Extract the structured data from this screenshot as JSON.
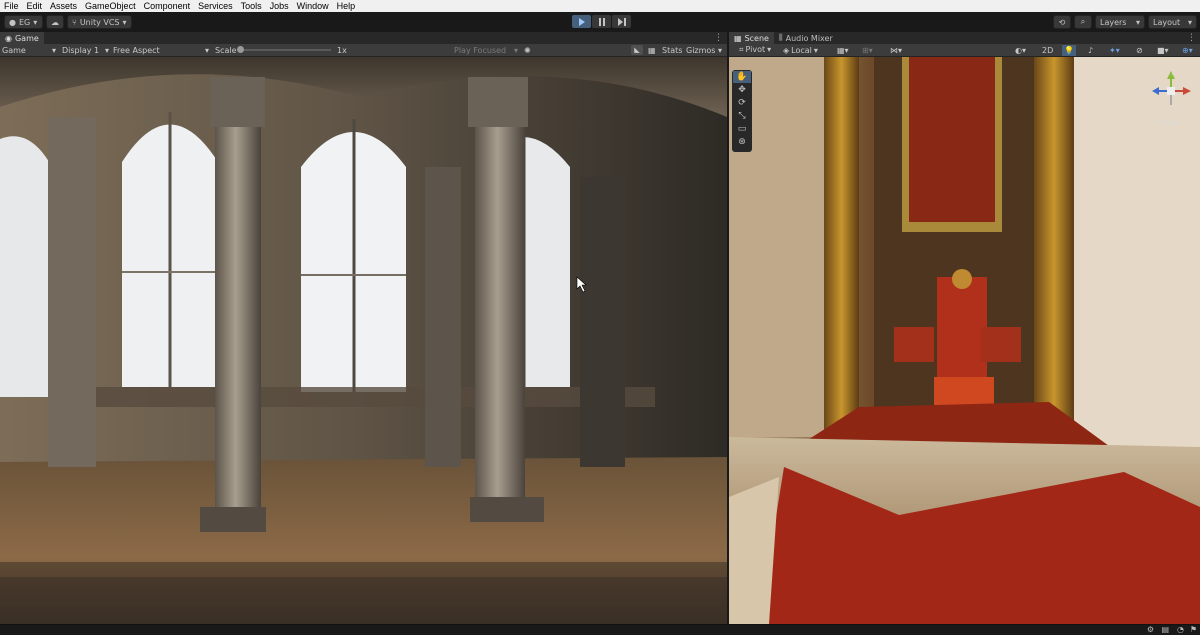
{
  "menu": [
    "File",
    "Edit",
    "Assets",
    "GameObject",
    "Component",
    "Services",
    "Tools",
    "Jobs",
    "Window",
    "Help"
  ],
  "toolbar": {
    "account": "EG",
    "vcs": "Unity VCS",
    "layers": "Layers",
    "layout": "Layout"
  },
  "game": {
    "tab": "Game",
    "view_mode": "Game",
    "display": "Display 1",
    "aspect": "Free Aspect",
    "scale_label": "Scale",
    "scale_value": "1x",
    "play_focused": "Play Focused",
    "stats": "Stats",
    "gizmos": "Gizmos"
  },
  "scene": {
    "tab_scene": "Scene",
    "tab_mixer": "Audio Mixer",
    "pivot": "Pivot",
    "local": "Local",
    "mode_2d": "2D",
    "persp": "< Persp"
  },
  "gizmo": {
    "z": "z",
    "x": "x",
    "y": "y"
  },
  "colors": {
    "accent": "#46607c",
    "toolbar_bg": "#191919",
    "panel_bg": "#3c3c3c",
    "carpet": "#a32716"
  }
}
